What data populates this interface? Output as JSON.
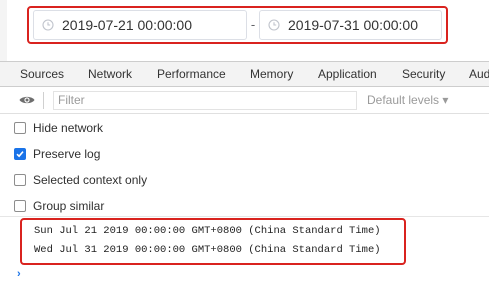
{
  "date_range": {
    "start": "2019-07-21 00:00:00",
    "separator": "-",
    "end": "2019-07-31 00:00:00",
    "icon": "clock-icon",
    "highlight_color": "#d9231f"
  },
  "devtools": {
    "tabs": [
      "Sources",
      "Network",
      "Performance",
      "Memory",
      "Application",
      "Security",
      "Aud"
    ],
    "toolbar": {
      "eye_icon": "eye-icon",
      "filter_placeholder": "Filter",
      "levels_label": "Default levels ▾"
    },
    "options": [
      {
        "label": "Hide network",
        "checked": false
      },
      {
        "label": "Preserve log",
        "checked": true
      },
      {
        "label": "Selected context only",
        "checked": false
      },
      {
        "label": "Group similar",
        "checked": false
      }
    ],
    "console": {
      "lines": [
        "Sun Jul 21 2019 00:00:00 GMT+0800 (China Standard Time)",
        "Wed Jul 31 2019 00:00:00 GMT+0800 (China Standard Time)"
      ],
      "prompt": "›"
    },
    "accent_color": "#1a73e8"
  }
}
